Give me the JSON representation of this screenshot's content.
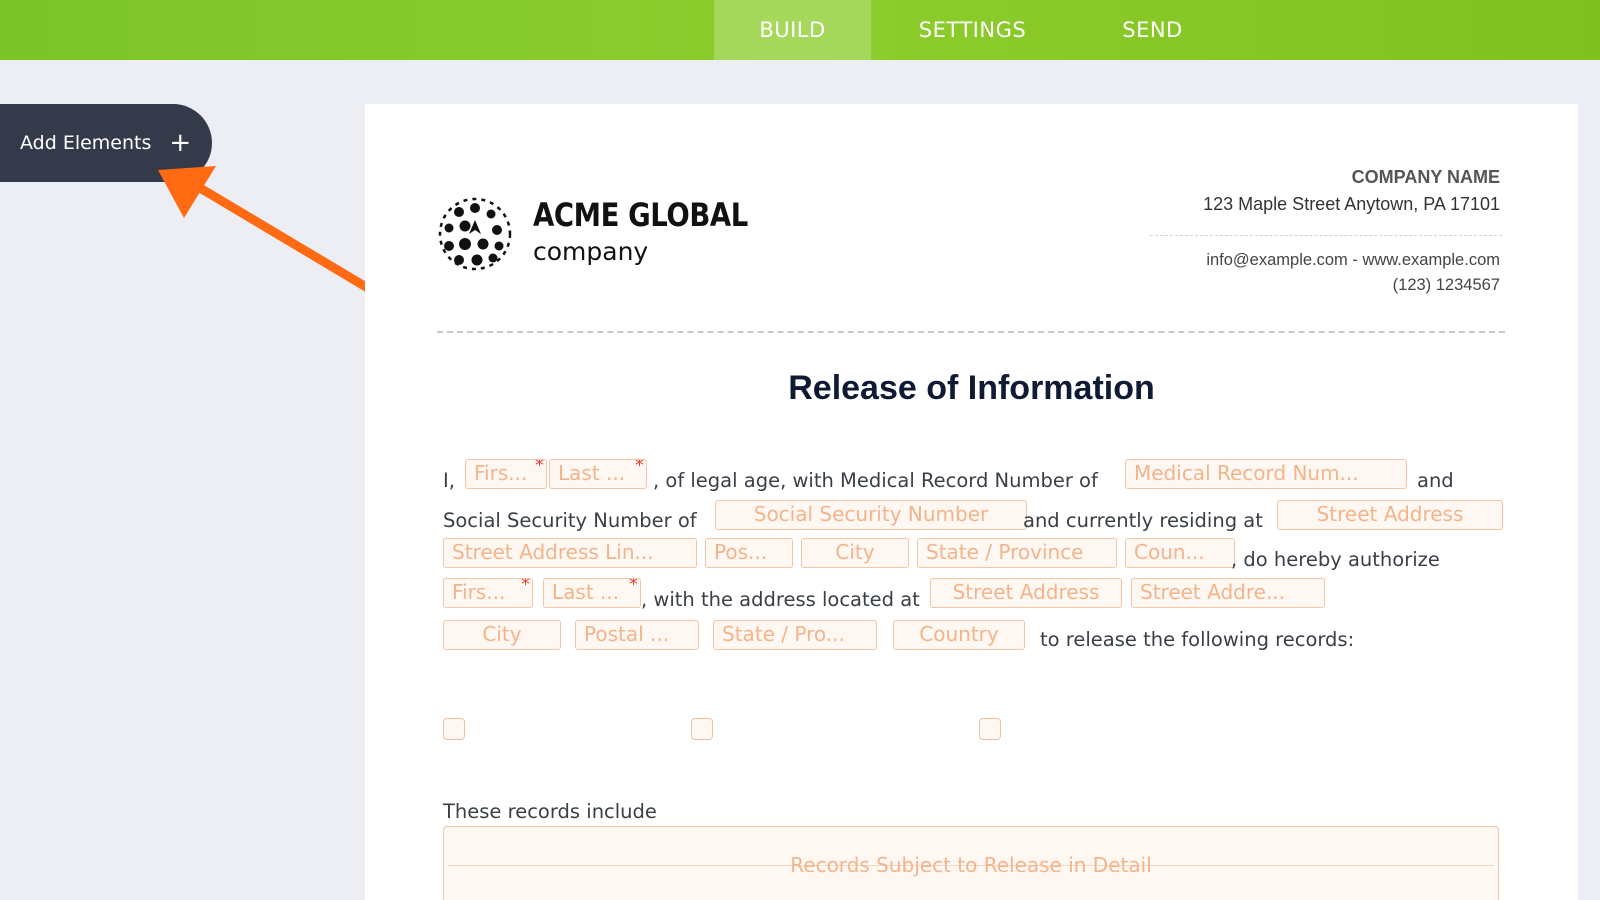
{
  "nav": {
    "tabs": [
      "BUILD",
      "SETTINGS",
      "SEND"
    ],
    "active_tab": "BUILD",
    "bg_color": "#7cc42a"
  },
  "sidebar": {
    "add_elements_label": "Add Elements",
    "add_icon": "+"
  },
  "header": {
    "brand_name": "ACME GLOBAL",
    "brand_sub": "company",
    "company_name": "COMPANY NAME",
    "address": "123 Maple Street Anytown, PA 17101",
    "contact": "info@example.com - www.example.com",
    "phone": "(123) 1234567"
  },
  "document": {
    "title": "Release of Information",
    "text": {
      "i": "I,",
      "legal_age": ", of legal age, with Medical Record Number of",
      "and": "and",
      "ssn_of": "Social Security Number of",
      "residing": "and currently residing at",
      "authorize": ", do hereby authorize",
      "address_at": ", with the address located at",
      "release": "to release the following records:",
      "records_include": "These records include"
    },
    "fields": {
      "first1": "Firs...",
      "last1": "Last ...",
      "medical": "Medical Record Num...",
      "ssn": "Social Security Number",
      "street1": "Street Address",
      "street_line": "Street Address Lin...",
      "postal1": "Pos...",
      "city1": "City",
      "state1": "State / Province",
      "country1": "Coun...",
      "first2": "Firs...",
      "last2": "Last ...",
      "street2": "Street Address",
      "street2_line": "Street Addre...",
      "city2": "City",
      "postal2": "Postal ...",
      "state2": "State / Pro...",
      "country2": "Country",
      "records_detail": "Records Subject to Release in Detail"
    },
    "required_mark": "*"
  },
  "colors": {
    "field_border": "#f2c5a6",
    "field_text": "#f3b48c",
    "arrow": "#ff6a13",
    "sidebar": "#343a4a"
  }
}
